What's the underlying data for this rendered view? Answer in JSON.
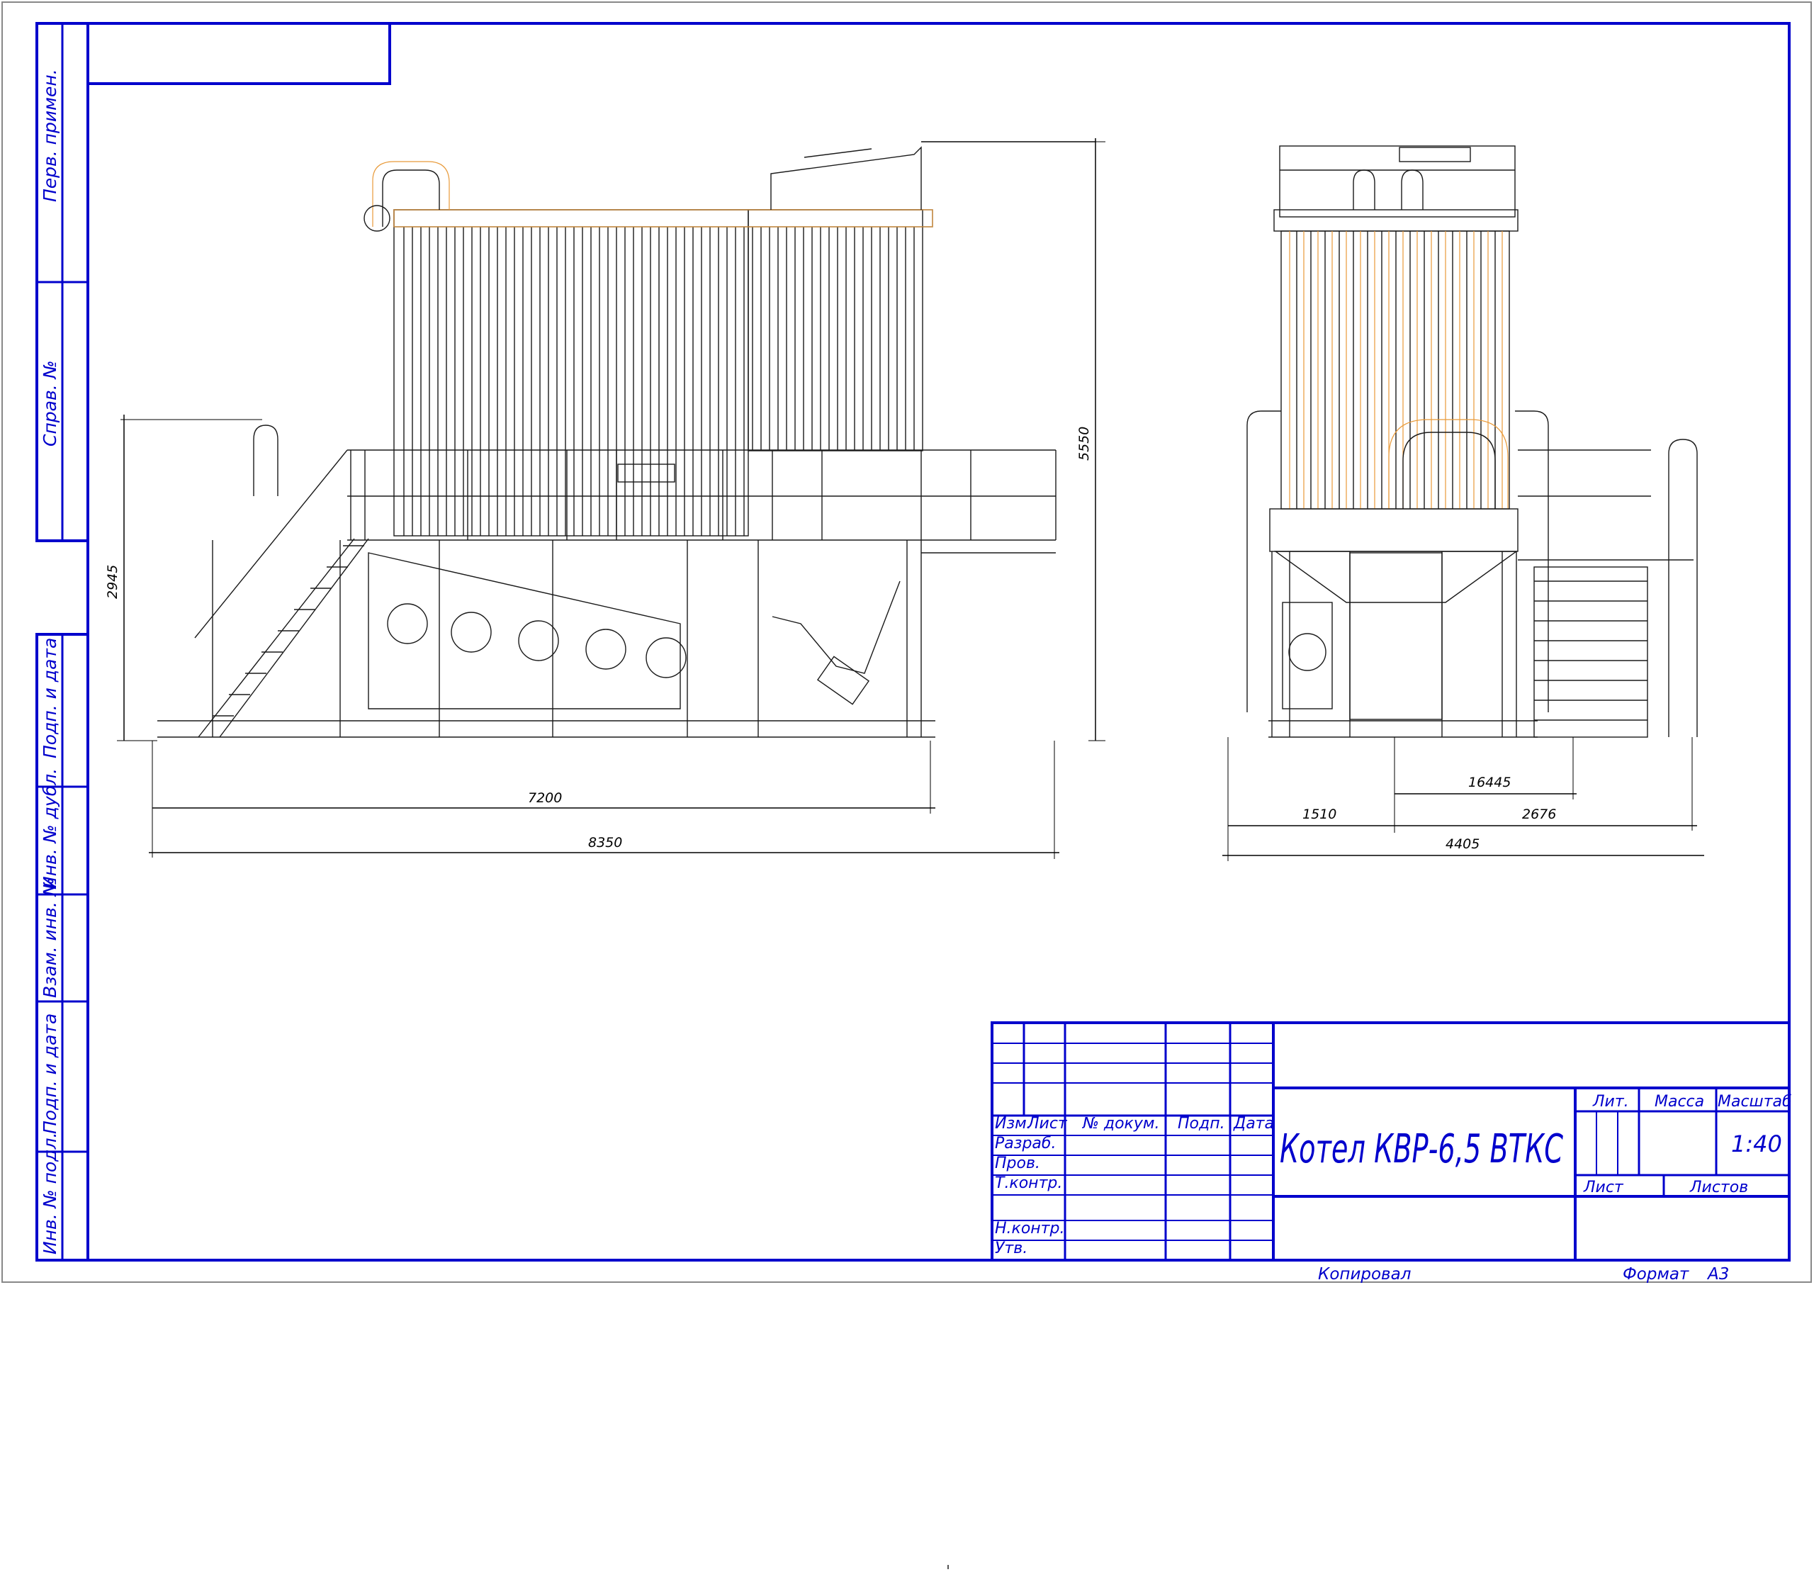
{
  "side_stamp": {
    "perv_primen": "Перв. примен.",
    "sprav_no": "Справ. №",
    "podp_data_1": "Подп. и дата",
    "inv_dubl": "Инв. № дубл.",
    "vzam_inv": "Взам. инв. №",
    "podp_data_2": "Подп. и дата",
    "inv_podl": "Инв. № подл."
  },
  "dimensions": {
    "side_view": {
      "height_total": "5550",
      "height_platform": "2945",
      "length_frame": "7200",
      "length_total": "8350"
    },
    "front_view": {
      "d_16445": "16445",
      "d_1510": "1510",
      "d_2676": "2676",
      "d_4405": "4405"
    }
  },
  "title_block": {
    "col_izm": "Изм.",
    "col_list": "Лист",
    "col_dokum": "№ докум.",
    "col_podp": "Подп.",
    "col_data": "Дата",
    "row_razrab": "Разраб.",
    "row_prov": "Пров.",
    "row_tkontr": "Т.контр.",
    "row_nkontr": "Н.контр.",
    "row_utv": "Утв.",
    "title": "Котел КВР-6,5 ВТКС",
    "lit": "Лит.",
    "massa": "Масса",
    "masshtab": "Масштаб",
    "scale_value": "1:40",
    "list": "Лист",
    "listov": "Листов"
  },
  "footer": {
    "kopiroval": "Копировал",
    "format_label": "Формат",
    "format_value": "А3"
  },
  "colors": {
    "frame": "#0000cc",
    "lines": "#1a1a1a",
    "axis": "#e89a3a"
  }
}
